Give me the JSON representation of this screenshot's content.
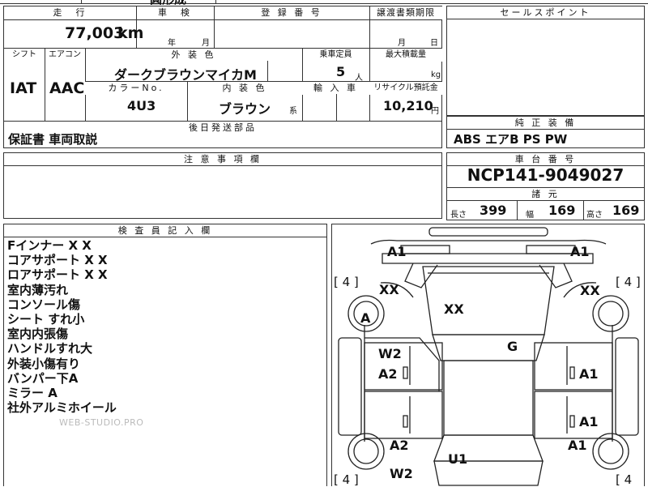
{
  "top_partial": {
    "text": "圓形成"
  },
  "mileage": {
    "header": "走　行",
    "value": "77,003",
    "unit": "km"
  },
  "inspection": {
    "header": "車　検",
    "year_unit": "年",
    "month_unit": "月"
  },
  "registration": {
    "header": "登 録 番 号"
  },
  "transfer": {
    "header": "譲渡書類期限",
    "month_unit": "月",
    "day_unit": "日"
  },
  "sales_point": {
    "header": "セールスポイント"
  },
  "shift": {
    "header": "シフト",
    "value": "IAT"
  },
  "aircon": {
    "header": "エアコン",
    "value": "AAC"
  },
  "exterior_color": {
    "header": "外 装 色",
    "value": "ダークブラウンマイカM"
  },
  "capacity": {
    "header": "乗車定員",
    "value": "5",
    "unit": "人"
  },
  "max_load": {
    "header": "最大積載量",
    "unit": "kg"
  },
  "color_no": {
    "header": "カラーNo.",
    "value": "4U3"
  },
  "interior_color": {
    "header": "内 装 色",
    "value": "ブラウン",
    "suffix": "系"
  },
  "import": {
    "header": "輸 入 車"
  },
  "recycle": {
    "header": "リサイクル預託金",
    "value": "10,210",
    "unit": "円"
  },
  "later_parts": {
    "header": "後日発送部品",
    "value": "保証書 車両取説"
  },
  "genuine_equipment": {
    "header": "純 正 装 備",
    "value": "ABS エアB PS PW"
  },
  "notes": {
    "header": "注 意 事 項 欄"
  },
  "chassis": {
    "header": "車 台 番 号",
    "value": "NCP141-9049027"
  },
  "specs": {
    "header": "諸 元",
    "length_label": "長さ",
    "length_value": "399",
    "width_label": "幅",
    "width_value": "169",
    "height_label": "高さ",
    "height_value": "169"
  },
  "inspector": {
    "header": "検 査 員 記 入 欄",
    "lines": [
      "Fインナー X X",
      "コアサポート X X",
      "ロアサポート X X",
      "室内薄汚れ",
      "コンソール傷",
      "シート すれ小",
      "室内内張傷",
      "ハンドルすれ大",
      "外装小傷有り",
      "バンパー下A",
      "ミラー A",
      "社外アルミホイール"
    ]
  },
  "watermark": "WEB-STUDIO.PRO",
  "diagram": {
    "a1_front_left": "A1",
    "a1_front_right": "A1",
    "bracket_top_left": "[ 4 ]",
    "bracket_top_right": "[ 4 ]",
    "bracket_bottom_left": "[ 4 ]",
    "bracket_bottom_right": "[ 4",
    "xx_left": "XX",
    "xx_right": "XX",
    "xx_hood": "XX",
    "a_wheel": "A",
    "g_roof": "G",
    "w2_left_front": "W2",
    "a2_left_front": "A2",
    "a1_right_front": "A1",
    "a1_right_rear": "A1",
    "a2_left_rear": "A2",
    "a1_rear_right": "A1",
    "u1_trunk": "U1",
    "w2_left_rear": "W2"
  }
}
